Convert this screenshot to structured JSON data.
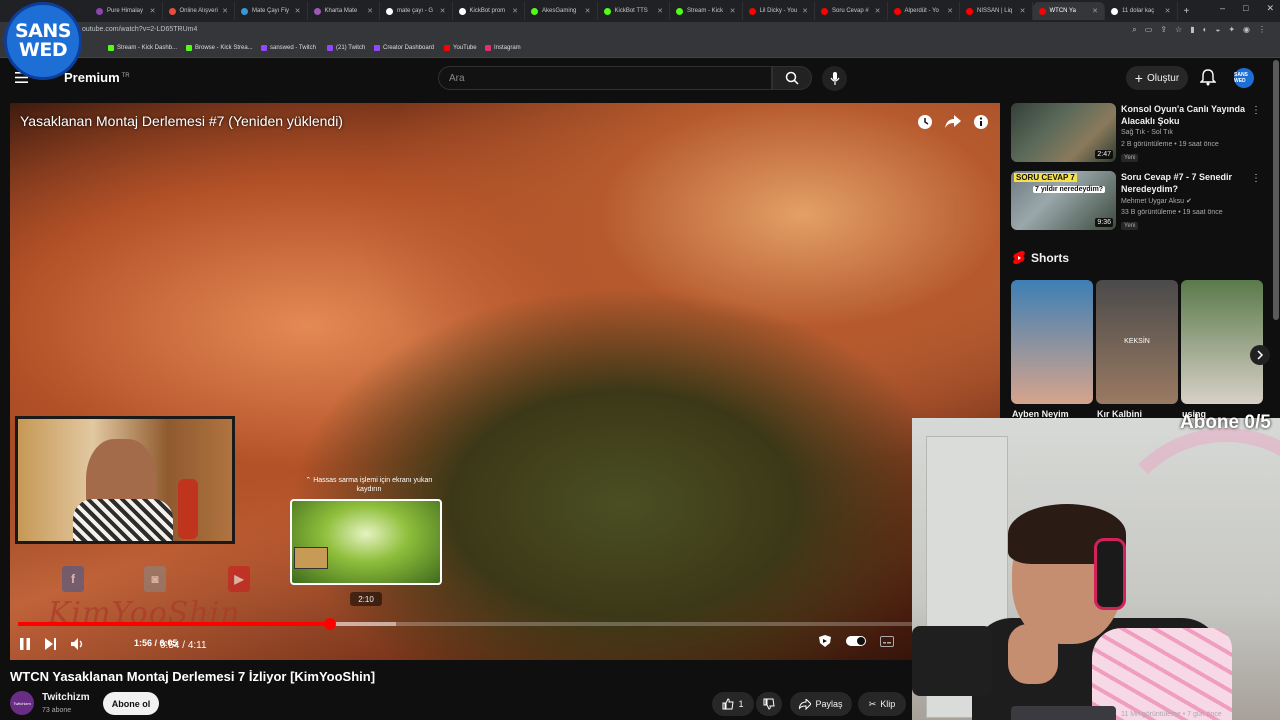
{
  "browser": {
    "tabs": [
      {
        "label": "Pure Himalay",
        "color": "#8e44ad"
      },
      {
        "label": "Online Alışveri",
        "color": "#e74c3c"
      },
      {
        "label": "Mate Çayı Fiy",
        "color": "#3498db"
      },
      {
        "label": "Kharta Mate",
        "color": "#9b59b6"
      },
      {
        "label": "mate çayı - G",
        "color": "#ffffff"
      },
      {
        "label": "KickBot prom",
        "color": "#ffffff"
      },
      {
        "label": "AkesGaming",
        "color": "#53fc18"
      },
      {
        "label": "KickBot TTS",
        "color": "#53fc18"
      },
      {
        "label": "Stream - Kick",
        "color": "#53fc18"
      },
      {
        "label": "Lil Dicky - You",
        "color": "#ff0000"
      },
      {
        "label": "Soru Cevap #",
        "color": "#ff0000"
      },
      {
        "label": "Alperdüt - Yo",
        "color": "#ff0000"
      },
      {
        "label": "NISSAN | Liq",
        "color": "#ff0000"
      },
      {
        "label": "WTCN Ya",
        "color": "#ff0000"
      },
      {
        "label": "11 dolar kaç",
        "color": "#ffffff"
      }
    ],
    "url": "outube.com/watch?v=2-LD65TRUm4",
    "bookmarks": [
      {
        "label": "Stream - Kick Dashb...",
        "color": "#53fc18"
      },
      {
        "label": "Browse - Kick Strea...",
        "color": "#53fc18"
      },
      {
        "label": "sanswed - Twitch",
        "color": "#9146ff"
      },
      {
        "label": "(21) Twitch",
        "color": "#9146ff"
      },
      {
        "label": "Creator Dashboard",
        "color": "#9146ff"
      },
      {
        "label": "YouTube",
        "color": "#ff0000"
      },
      {
        "label": "Instagram",
        "color": "#e1306c"
      }
    ]
  },
  "logo": {
    "line1": "SANS",
    "line2": "WED"
  },
  "header": {
    "brand": "Premium",
    "brand_region": "TR",
    "search_placeholder": "Ara",
    "create_label": "Oluştur",
    "avatar_text": "SANS WED"
  },
  "video": {
    "overlay_title": "Yasaklanan Montaj Derlemesi #7 (Yeniden yüklendi)",
    "watermark": "KimYooShin",
    "social": [
      {
        "letter": "f",
        "color": "#3b5998"
      },
      {
        "letter": "◙",
        "color": "#888888"
      },
      {
        "letter": "▶",
        "color": "#cc181e"
      }
    ],
    "seek_tooltip": "Hassas sarma işlemi için ekranı yukarı kaydırın",
    "preview_time": "2:10",
    "progress_fraction": 0.318,
    "buffer_fraction": 0.385,
    "time_current": "0:54",
    "time_total": "4:11",
    "stream_time": "1:56 / 6:05"
  },
  "overlay": {
    "sub_goal": "Abone 0/5"
  },
  "below": {
    "title": "WTCN Yasaklanan Montaj Derlemesi 7 İzliyor [KimYooShin]",
    "channel": "Twitchizm",
    "channel_avatar_text": "Twitchizm",
    "subs": "73 abone",
    "subscribe_label": "Abone ol",
    "likes": "1",
    "share_label": "Paylaş",
    "clip_label": "Klip"
  },
  "sidebar": {
    "videos": [
      {
        "title": "Konsol Oyun'a Canlı Yayında Alacaklı Şoku",
        "channel": "Sağ Tık - Sol Tık",
        "stats": "2 B görüntüleme • 19 saat önce",
        "badge": "Yeni",
        "duration": "2:47",
        "verified": false
      },
      {
        "title": "Soru Cevap #7 - 7 Senedir Neredeydim?",
        "channel": "Mehmet Uygar Aksu",
        "stats": "33 B görüntüleme • 19 saat önce",
        "badge": "Yeni",
        "duration": "9:36",
        "verified": true,
        "thumb_text": "SORU CEVAP 7",
        "thumb_sub": "7 yıldır neredeydim?"
      }
    ],
    "shorts_title": "Shorts",
    "shorts": [
      {
        "label": "Ayben Neyim",
        "colors": [
          "#3d7fb5",
          "#d6a48c"
        ]
      },
      {
        "label": "Kır Kalbini",
        "colors": [
          "#4a4a4a",
          "#9a7a62"
        ],
        "overlay": "KEKSİN"
      },
      {
        "label": "using",
        "colors": [
          "#5a7a4a",
          "#d8d0c8"
        ]
      }
    ],
    "bottom_meta": "11 Mn görüntüleme • 7 gün önce"
  }
}
